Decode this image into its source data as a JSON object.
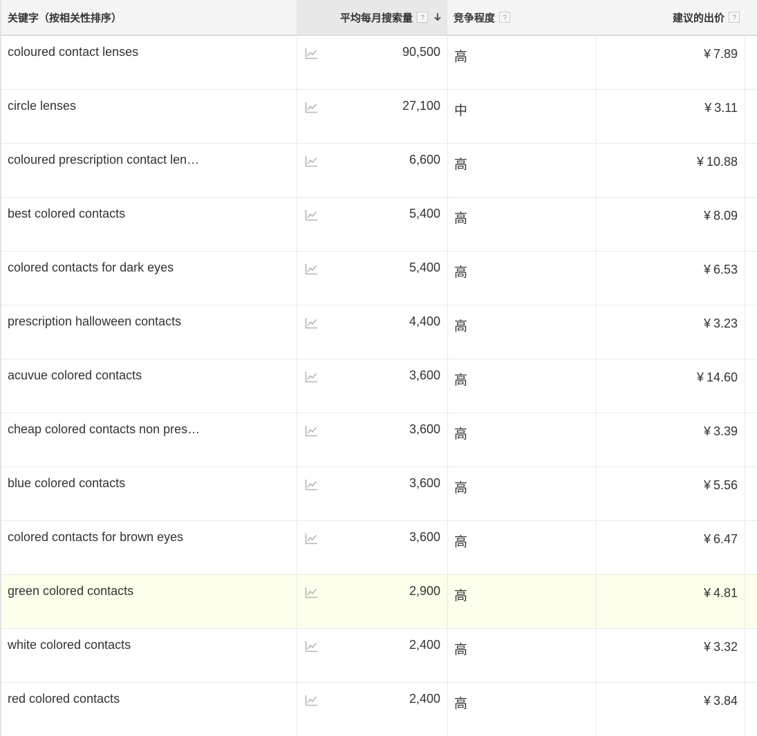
{
  "header": {
    "keyword": "关键字（按相关性排序）",
    "volume": "平均每月搜索量",
    "competition": "竞争程度",
    "bid": "建议的出价",
    "help_glyph": "?"
  },
  "currency": "¥",
  "rows": [
    {
      "keyword": "coloured contact lenses",
      "volume": "90,500",
      "competition": "高",
      "bid": "7.89"
    },
    {
      "keyword": "circle lenses",
      "volume": "27,100",
      "competition": "中",
      "bid": "3.11"
    },
    {
      "keyword": "coloured prescription contact len…",
      "volume": "6,600",
      "competition": "高",
      "bid": "10.88"
    },
    {
      "keyword": "best colored contacts",
      "volume": "5,400",
      "competition": "高",
      "bid": "8.09"
    },
    {
      "keyword": "colored contacts for dark eyes",
      "volume": "5,400",
      "competition": "高",
      "bid": "6.53"
    },
    {
      "keyword": "prescription halloween contacts",
      "volume": "4,400",
      "competition": "高",
      "bid": "3.23"
    },
    {
      "keyword": "acuvue colored contacts",
      "volume": "3,600",
      "competition": "高",
      "bid": "14.60"
    },
    {
      "keyword": "cheap colored contacts non pres…",
      "volume": "3,600",
      "competition": "高",
      "bid": "3.39"
    },
    {
      "keyword": "blue colored contacts",
      "volume": "3,600",
      "competition": "高",
      "bid": "5.56"
    },
    {
      "keyword": "colored contacts for brown eyes",
      "volume": "3,600",
      "competition": "高",
      "bid": "6.47"
    },
    {
      "keyword": "green colored contacts",
      "volume": "2,900",
      "competition": "高",
      "bid": "4.81",
      "highlighted": true
    },
    {
      "keyword": "white colored contacts",
      "volume": "2,400",
      "competition": "高",
      "bid": "3.32"
    },
    {
      "keyword": "red colored contacts",
      "volume": "2,400",
      "competition": "高",
      "bid": "3.84"
    }
  ],
  "colors": {
    "header_bg": "#f5f5f5",
    "sorted_header_bg": "#e8e8e8",
    "highlight_row_bg": "#fdfeeb",
    "icon_gray": "#b5b5b5",
    "text": "#333333"
  },
  "icons": {
    "trend": "line-chart-icon",
    "help": "question-mark-icon",
    "sort": "arrow-down-icon"
  }
}
